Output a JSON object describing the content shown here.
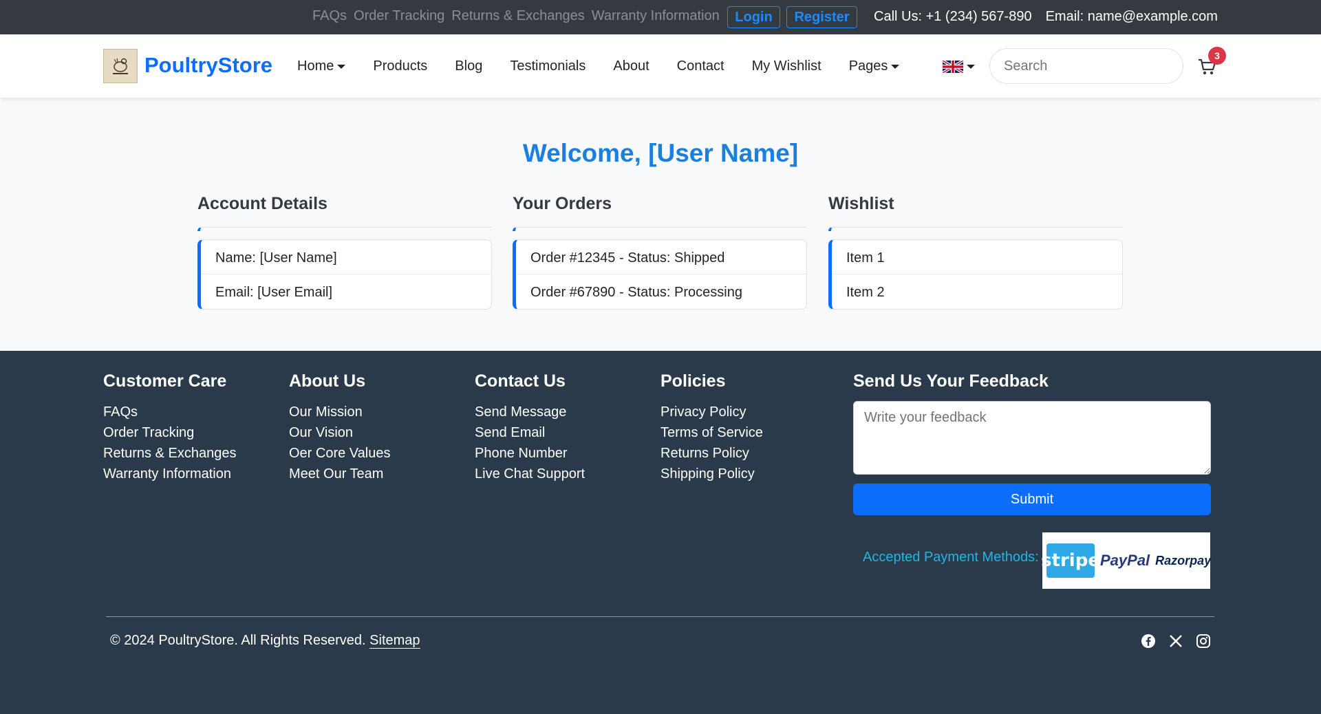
{
  "topbar": {
    "links": [
      "FAQs",
      "Order Tracking",
      "Returns & Exchanges",
      "Warranty Information"
    ],
    "login": "Login",
    "register": "Register",
    "phone": "Call Us: +1 (234) 567-890",
    "email": "Email: name@example.com"
  },
  "navbar": {
    "brand": "PoultryStore",
    "items": [
      "Home",
      "Products",
      "Blog",
      "Testimonials",
      "About",
      "Contact",
      "My Wishlist",
      "Pages"
    ],
    "search_placeholder": "Search",
    "cart_count": "3",
    "language_icon": "uk-flag-icon"
  },
  "main": {
    "welcome": "Welcome, [User Name]",
    "sections": [
      {
        "title": "Account Details",
        "rows": [
          "Name: [User Name]",
          "Email: [User Email]"
        ]
      },
      {
        "title": "Your Orders",
        "rows": [
          "Order #12345 - Status: Shipped",
          "Order #67890 - Status: Processing"
        ]
      },
      {
        "title": "Wishlist",
        "rows": [
          "Item 1",
          "Item 2"
        ]
      }
    ]
  },
  "footer": {
    "columns": [
      {
        "title": "Customer Care",
        "links": [
          "FAQs",
          "Order Tracking",
          "Returns & Exchanges",
          "Warranty Information"
        ]
      },
      {
        "title": "About Us",
        "links": [
          "Our Mission",
          "Our Vision",
          "Oer Core Values",
          "Meet Our Team"
        ]
      },
      {
        "title": "Contact Us",
        "links": [
          "Send Message",
          "Send Email",
          "Phone Number",
          "Live Chat Support"
        ]
      },
      {
        "title": "Policies",
        "links": [
          "Privacy Policy",
          "Terms of Service",
          "Returns Policy",
          "Shipping Policy"
        ]
      }
    ],
    "feedback_title": "Send Us Your Feedback",
    "feedback_placeholder": "Write your feedback",
    "submit": "Submit",
    "payment_label": "Accepted Payment Methods:",
    "payment_methods": [
      "stripe",
      "PayPal",
      "Razorpay"
    ],
    "copyright": "© 2024 PoultryStore. All Rights Reserved.",
    "sitemap": "Sitemap",
    "social_icons": [
      "facebook-icon",
      "x-icon",
      "instagram-icon"
    ]
  },
  "colors": {
    "accent": "#0d6efd",
    "topbar": "#343a40",
    "footer": "#2b3a4a",
    "badge": "#dc3545"
  }
}
